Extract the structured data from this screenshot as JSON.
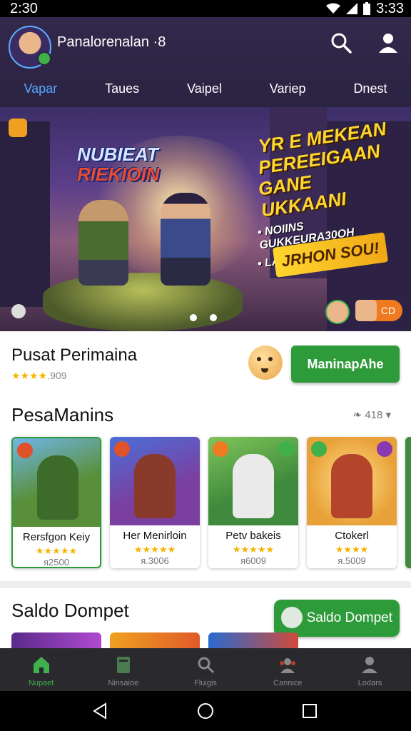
{
  "status_bar": {
    "time_left": "2:30",
    "time_right": "3:33"
  },
  "header": {
    "user_name": "Panalorenalan ·8",
    "icons": [
      "search-icon",
      "profile-icon"
    ],
    "tabs": [
      {
        "label": "Vapar",
        "active": true
      },
      {
        "label": "Taues",
        "active": false
      },
      {
        "label": "Vaipel",
        "active": false
      },
      {
        "label": "Variep",
        "active": false
      },
      {
        "label": "Dnest",
        "active": false
      }
    ]
  },
  "banner": {
    "game_title_line1": "NUBIEAT",
    "game_title_line2": "RIEKIOIN",
    "promo_line1": "YR E MEKEAN",
    "promo_line2": "PEREEIGAAN",
    "promo_line3": "GANE UKKAANI",
    "promo_sub1": "• NOIINS GUKKEURA30OH",
    "promo_sub2": "• LAPROI SHBATIIAN",
    "promo_cta": "JRHON SOU!",
    "pill_label": "CD",
    "slide_count": 2,
    "active_slide": 0
  },
  "featured": {
    "title": "Pusat Perimaina",
    "stars": "★★★★",
    "rating_text": ".909",
    "play_button": "ManinapAhe"
  },
  "section_games": {
    "title": "PesaManins",
    "meta": "418",
    "cards": [
      {
        "name": "Rersfgon Keiy",
        "stars": "★★★★★",
        "price": "ᴙ2500",
        "selected": true,
        "art_bg": "#5a8f3a",
        "figure": "#3c6b2a"
      },
      {
        "name": "Her Menirloin",
        "stars": "★★★★★",
        "price": "ᴙ.3006",
        "selected": false,
        "art_bg": "#7b3fa0",
        "figure": "#8a3a2a"
      },
      {
        "name": "Petv bakeis",
        "stars": "★★★★★",
        "price": "ᴙ6009",
        "selected": false,
        "art_bg": "#3f8a3c",
        "figure": "#eaeaea"
      },
      {
        "name": "Ctokerl",
        "stars": "★★★★",
        "price": "ᴙ.5009",
        "selected": false,
        "art_bg": "#e9a23a",
        "figure": "#b5452a"
      }
    ]
  },
  "wallet": {
    "title": "Saldo Dompet",
    "button": "Saldo Dompet"
  },
  "bottom_nav": [
    {
      "label": "Nupaet",
      "icon": "home-icon",
      "active": true
    },
    {
      "label": "Ninsaioe",
      "icon": "book-icon",
      "active": false
    },
    {
      "label": "Fluigis",
      "icon": "search-icon",
      "active": false
    },
    {
      "label": "Cannice",
      "icon": "community-icon",
      "active": false
    },
    {
      "label": "Lodars",
      "icon": "profile-icon",
      "active": false
    }
  ],
  "system_nav": [
    "back-icon",
    "home-circle-icon",
    "recents-icon"
  ]
}
